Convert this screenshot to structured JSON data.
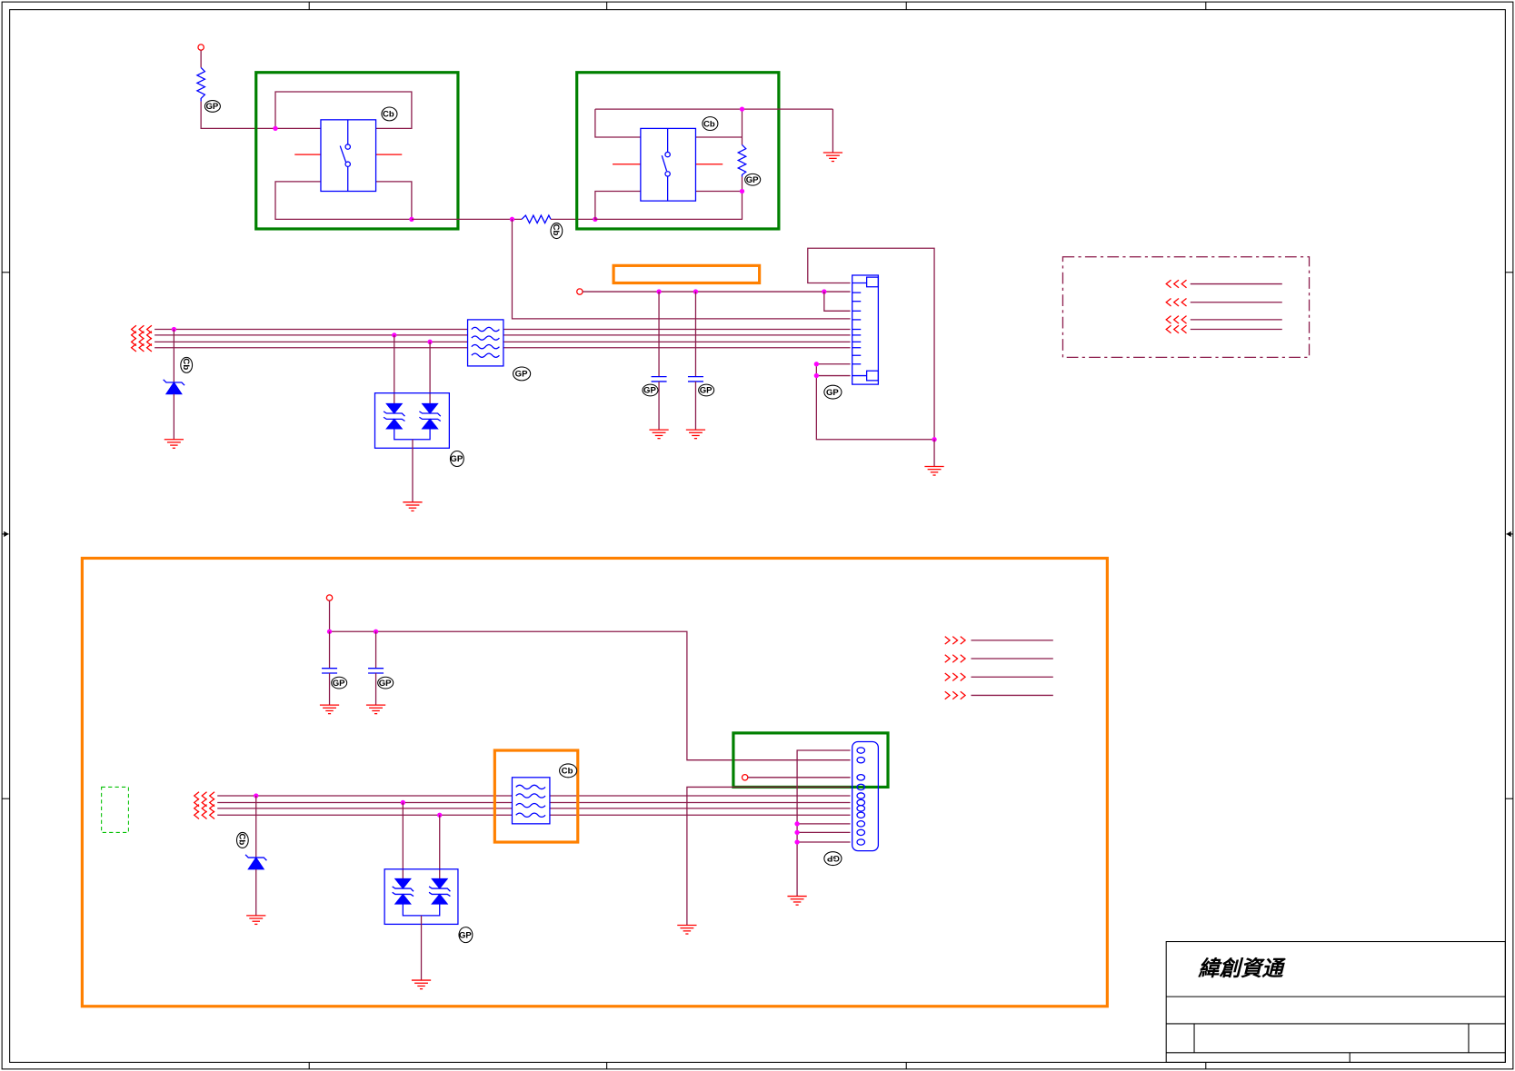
{
  "title_block": {
    "company": "緯創資通"
  },
  "markers": {
    "gp": "GP",
    "cb": "Cb"
  },
  "colors": {
    "wire": "#8b1a4a",
    "pin_stub": "#ff0000",
    "component": "#0000ff",
    "junction": "#ff00ff",
    "highlight_green": "#008000",
    "highlight_orange": "#ff8000"
  }
}
